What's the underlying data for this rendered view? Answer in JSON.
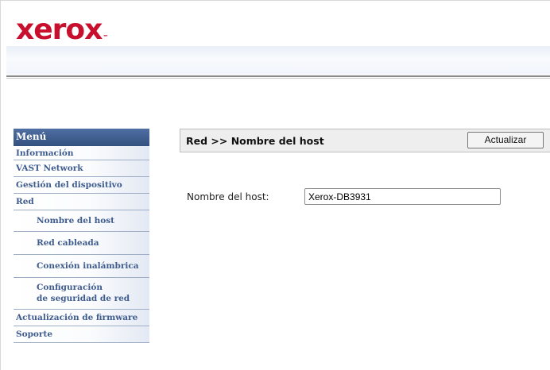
{
  "brand": {
    "logo_text": "xerox",
    "trademark": "™"
  },
  "menu": {
    "title": "Menú",
    "items": [
      {
        "label": "Información"
      },
      {
        "label": "VAST Network"
      },
      {
        "label": "Gestión del dispositivo"
      },
      {
        "label": "Red"
      },
      {
        "label": "Nombre del host"
      },
      {
        "label": "Red cableada"
      },
      {
        "label": "Conexión inalámbrica"
      },
      {
        "label_line1": "Configuración",
        "label_line2": "de seguridad de red"
      },
      {
        "label": "Actualización de firmware"
      },
      {
        "label": "Soporte"
      }
    ]
  },
  "header": {
    "breadcrumb": "Red >> Nombre del host",
    "refresh_label": "Actualizar"
  },
  "form": {
    "host_label": "Nombre del host:",
    "host_value": "Xerox-DB3931"
  },
  "colors": {
    "brand_red": "#c8102e",
    "menu_header": "#3d5a8a",
    "menu_text": "#3f5c8e"
  }
}
